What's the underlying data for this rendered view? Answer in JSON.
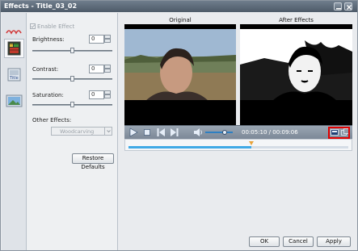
{
  "window": {
    "title": "Effects - Title_03_02"
  },
  "panel": {
    "enable_effect": "Enable Effect",
    "brightness": {
      "label": "Brightness:",
      "value": "0",
      "level": 0.5
    },
    "contrast": {
      "label": "Contrast:",
      "value": "0",
      "level": 0.5
    },
    "saturation": {
      "label": "Saturation:",
      "value": "0",
      "level": 0.5
    },
    "other_effects": {
      "label": "Other Effects:",
      "selected": "Woodcarving"
    },
    "restore_defaults": "Restore Defaults"
  },
  "preview": {
    "original_label": "Original",
    "after_label": "After Effects",
    "time": "00:05:10 / 00:09:06",
    "progress": 0.56,
    "volume": 0.7
  },
  "buttons": {
    "ok": "OK",
    "cancel": "Cancel",
    "apply": "Apply"
  },
  "colors": {
    "accent": "#3fa9e6",
    "highlight": "#e00000"
  },
  "icons": [
    "close-icon",
    "minimize-icon",
    "play-icon",
    "stop-icon",
    "prev-icon",
    "next-icon",
    "volume-icon",
    "single-view-icon",
    "split-view-icon",
    "crop-tool-icon",
    "effect-tool-icon",
    "title-tool-icon",
    "picture-tool-icon"
  ]
}
